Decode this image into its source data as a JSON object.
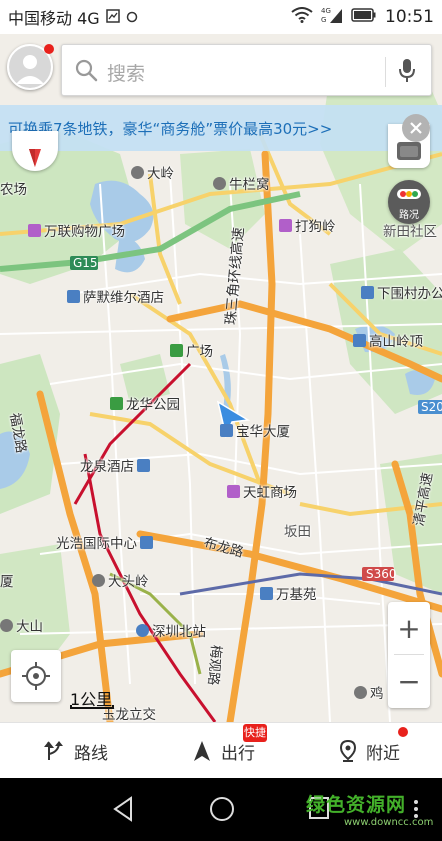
{
  "status_bar": {
    "carrier": "中国移动 4G",
    "time": "10:51",
    "icons": [
      "wifi-icon",
      "signal-4g-icon",
      "battery-icon"
    ]
  },
  "search": {
    "placeholder": "搜索"
  },
  "banner": {
    "text": "可换乘7条地铁，豪华“商务舱”票价最高30元>>"
  },
  "controls": {
    "traffic_label": "路况",
    "zoom_in": "+",
    "zoom_out": "−",
    "scale_label": "1公里"
  },
  "map_labels": {
    "places": [
      {
        "key": "dalin",
        "text": "大岭"
      },
      {
        "key": "niulanwo",
        "text": "牛栏窝"
      },
      {
        "key": "nongchang",
        "text": "农场"
      },
      {
        "key": "wanlian",
        "text": "万联购物广场"
      },
      {
        "key": "dagouling",
        "text": "打狗岭"
      },
      {
        "key": "xinsheshequ",
        "text": "新田社区"
      },
      {
        "key": "g15",
        "text": "G15"
      },
      {
        "key": "saimo",
        "text": "萨默维尔酒店"
      },
      {
        "key": "xiaweicun",
        "text": "下围村办公"
      },
      {
        "key": "guangchang",
        "text": "广场"
      },
      {
        "key": "gaoshanling",
        "text": "高山岭顶"
      },
      {
        "key": "zhusanjiao",
        "text": "珠三角环线高速"
      },
      {
        "key": "longhuagongyuan",
        "text": "龙华公园"
      },
      {
        "key": "baohuadasha",
        "text": "宝华大厦"
      },
      {
        "key": "s20",
        "text": "S20"
      },
      {
        "key": "fulonglu",
        "text": "福龙路"
      },
      {
        "key": "longquanjiudian",
        "text": "龙泉酒店"
      },
      {
        "key": "tianhong",
        "text": "天虹商场"
      },
      {
        "key": "guangxuguoji",
        "text": "光浩国际中心"
      },
      {
        "key": "bantian",
        "text": "坂田"
      },
      {
        "key": "qingpinggaosu",
        "text": "清平高速"
      },
      {
        "key": "bulonglu",
        "text": "布龙路"
      },
      {
        "key": "s360",
        "text": "S360"
      },
      {
        "key": "datouling",
        "text": "大头岭"
      },
      {
        "key": "wanjiyuan",
        "text": "万基苑"
      },
      {
        "key": "xia",
        "text": "厦"
      },
      {
        "key": "dashan",
        "text": "大山"
      },
      {
        "key": "shenzhenbeizhan",
        "text": "深圳北站"
      },
      {
        "key": "meiguanlu",
        "text": "梅观路"
      },
      {
        "key": "jizhen",
        "text": "鸡"
      },
      {
        "key": "yulonglijiao",
        "text": "玉龙立交"
      }
    ]
  },
  "bottom_nav": {
    "route": "路线",
    "travel": "出行",
    "travel_badge": "快捷",
    "nearby": "附近"
  },
  "watermark": {
    "main": "绿色资源网",
    "url": "www.downcc.com"
  }
}
